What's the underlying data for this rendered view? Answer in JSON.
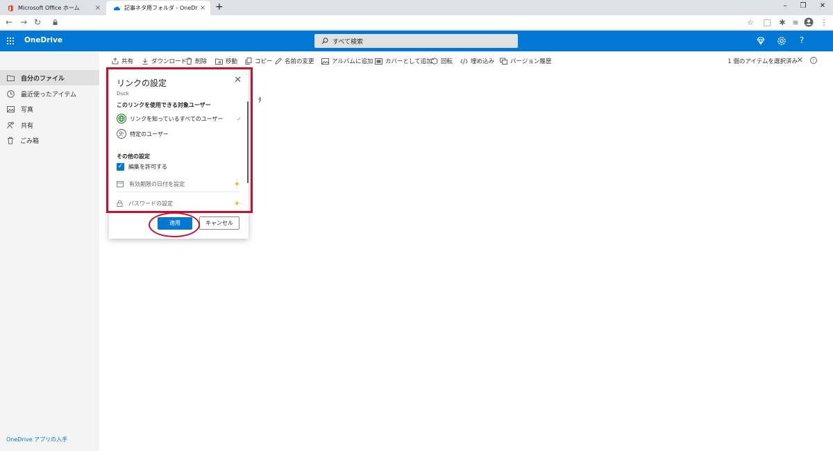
{
  "browser": {
    "tabs": [
      {
        "title": "Microsoft Office ホーム",
        "icon": "office-icon",
        "active": false
      },
      {
        "title": "記事ネタ用フォルダ - OneDrive",
        "icon": "onedrive-icon",
        "active": true
      }
    ],
    "close_glyph": "×",
    "new_tab_glyph": "+",
    "window_controls": {
      "minimize": "–",
      "restore": "❐",
      "close": "✕"
    },
    "nav": {
      "back": "←",
      "forward": "→",
      "reload": "↻"
    },
    "ext_glyphs": {
      "star": "☆",
      "puzzle": "✱",
      "menu": "⋮",
      "queue": "≡"
    }
  },
  "header": {
    "app_name": "OneDrive",
    "search_placeholder": "すべて検索",
    "help_glyph": "?",
    "accent_color": "#0078d4"
  },
  "sidebar": {
    "items": [
      {
        "label": "自分のファイル",
        "icon": "folder-icon",
        "active": true
      },
      {
        "label": "最近使ったアイテム",
        "icon": "clock-icon",
        "active": false
      },
      {
        "label": "写真",
        "icon": "photo-icon",
        "active": false
      },
      {
        "label": "共有",
        "icon": "share-people-icon",
        "active": false
      },
      {
        "label": "ごみ箱",
        "icon": "trash-icon",
        "active": false
      }
    ],
    "footer_link": "OneDrive アプリの入手"
  },
  "commandbar": {
    "commands": [
      {
        "label": "共有",
        "icon": "share-icon"
      },
      {
        "label": "ダウンロード",
        "icon": "download-icon"
      },
      {
        "label": "削除",
        "icon": "delete-icon"
      },
      {
        "label": "移動",
        "icon": "move-icon"
      },
      {
        "label": "コピー",
        "icon": "copy-icon"
      },
      {
        "label": "名前の変更",
        "icon": "rename-icon"
      },
      {
        "label": "アルバムに追加",
        "icon": "album-icon"
      },
      {
        "label": "カバーとして追加",
        "icon": "cover-icon"
      },
      {
        "label": "回転",
        "icon": "rotate-icon"
      },
      {
        "label": "埋め込み",
        "icon": "embed-icon"
      },
      {
        "label": "バージョン履歴",
        "icon": "history-icon"
      }
    ],
    "selection_info": "1 個のアイテムを選択済み",
    "clear_glyph": "✕",
    "info_glyph": "i"
  },
  "dialog": {
    "title": "リンクの設定",
    "close_glyph": "✕",
    "subtitle": "Duck",
    "audience_heading": "このリンクを使用できる対象ユーザー",
    "audience_options": [
      {
        "label": "リンクを知っているすべてのユーザー",
        "icon": "globe-icon",
        "selected": true,
        "check": "✓"
      },
      {
        "label": "特定のユーザー",
        "icon": "people-icon",
        "selected": false
      }
    ],
    "other_heading": "その他の設定",
    "allow_edit": {
      "label": "編集を許可する",
      "checked": true,
      "glyph": "✓"
    },
    "expiry": {
      "label": "有効期限の日付を設定",
      "premium_glyph": "✦"
    },
    "password": {
      "label": "パスワードの設定",
      "premium_glyph": "✦"
    },
    "apply_label": "適用",
    "cancel_label": "キャンセル"
  },
  "background_peek": "ﾀ",
  "annotation_color": "#c8102e"
}
